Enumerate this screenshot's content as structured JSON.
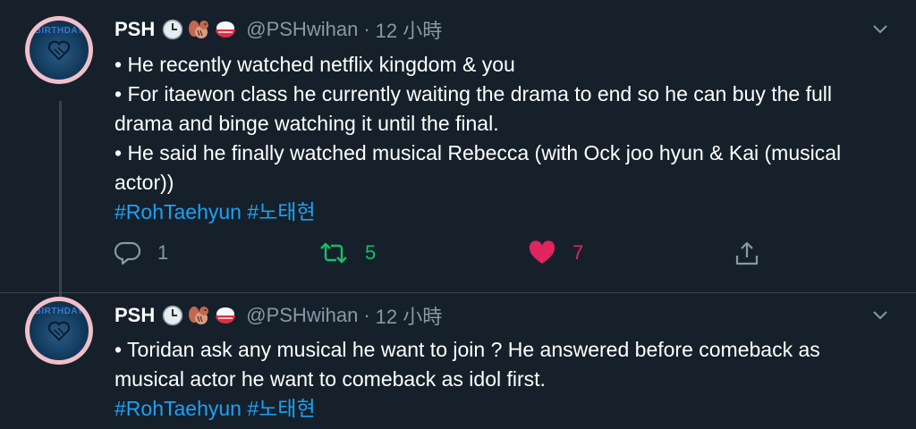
{
  "tweets": [
    {
      "author": {
        "name": "PSH",
        "handle": "@PSHwihan",
        "avatar_text": "BIRTHDAY"
      },
      "time": "12 小時",
      "dot": "·",
      "lines": [
        "• He recently watched netflix kingdom & you",
        "• For itaewon class he currently waiting the drama to end so he can buy the full drama and binge watching it until the final.",
        "• He said he finally watched musical Rebecca (with Ock joo hyun & Kai (musical actor))"
      ],
      "hashtags": "#RohTaehyun #노태현",
      "stats": {
        "replies": "1",
        "retweets": "5",
        "likes": "7"
      }
    },
    {
      "author": {
        "name": "PSH",
        "handle": "@PSHwihan",
        "avatar_text": "BIRTHDAY"
      },
      "time": "12 小時",
      "dot": "·",
      "lines": [
        "• Toridan ask any musical he want to join ? He answered before comeback as musical actor he want to comeback as idol first."
      ],
      "hashtags": "#RohTaehyun #노태현"
    }
  ],
  "icons": [
    "clock-emoji",
    "chipmunk-emoji",
    "rice-bowl-emoji",
    "chevron-down-icon",
    "reply-icon",
    "retweet-icon",
    "heart-icon",
    "share-icon"
  ],
  "colors": {
    "background": "#15202b",
    "secondary_text": "#8899a6",
    "link": "#1da1f2",
    "retweet": "#17bf63",
    "like": "#e0245e"
  }
}
